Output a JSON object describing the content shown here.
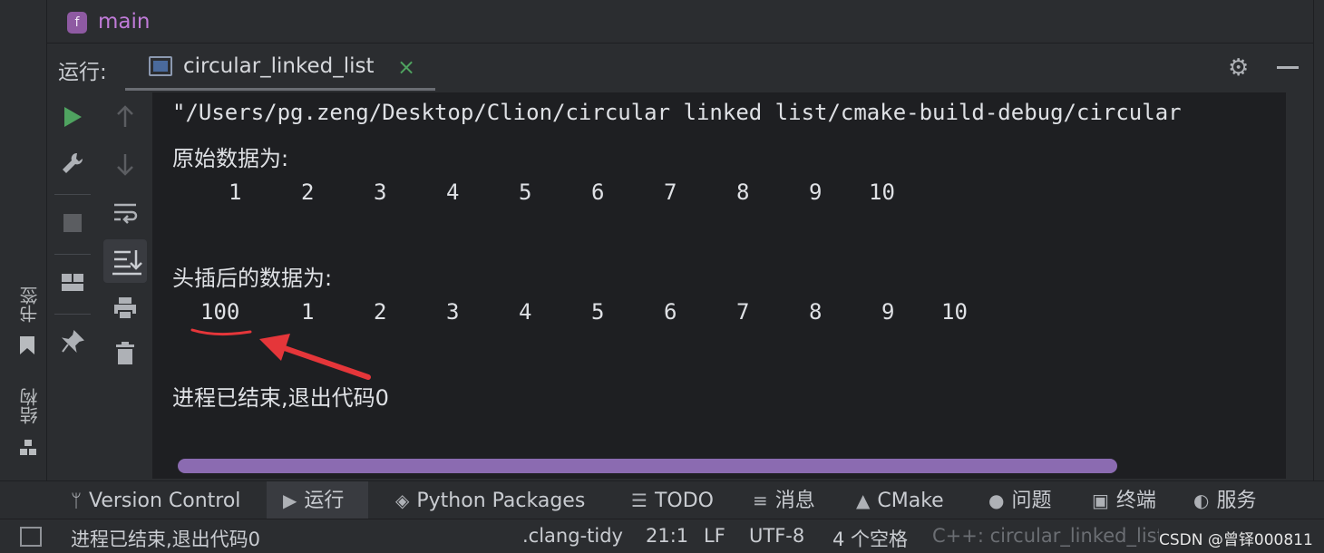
{
  "left_strip": {
    "bookmarks_label": "书签",
    "structure_label": "结构"
  },
  "file_bar": {
    "file_icon_letter": "f",
    "file_name": "main"
  },
  "run_panel": {
    "label": "运行:",
    "tab_name": "circular_linked_list",
    "close_glyph": "×"
  },
  "console": {
    "command": "\"/Users/pg.zeng/Desktop/Clion/circular linked list/cmake-build-debug/circular",
    "header_original": "原始数据为:",
    "original_values": [
      "1",
      "2",
      "3",
      "4",
      "5",
      "6",
      "7",
      "8",
      "9",
      "10"
    ],
    "header_inserted": "头插后的数据为:",
    "inserted_values": [
      "100",
      "1",
      "2",
      "3",
      "4",
      "5",
      "6",
      "7",
      "8",
      "9",
      "10"
    ],
    "exit_message": "进程已结束,退出代码0"
  },
  "tool_windows": [
    {
      "label": "Version Control",
      "icon": "branch-icon"
    },
    {
      "label": "运行",
      "icon": "play-icon"
    },
    {
      "label": "Python Packages",
      "icon": "layers-icon"
    },
    {
      "label": "TODO",
      "icon": "list-icon"
    },
    {
      "label": "消息",
      "icon": "message-icon"
    },
    {
      "label": "CMake",
      "icon": "triangle-icon"
    },
    {
      "label": "问题",
      "icon": "alert-icon"
    },
    {
      "label": "终端",
      "icon": "terminal-icon"
    },
    {
      "label": "服务",
      "icon": "services-icon"
    }
  ],
  "status_bar": {
    "message": "进程已结束,退出代码0",
    "linter": ".clang-tidy",
    "position": "21:1",
    "line_ending": "LF",
    "encoding": "UTF-8",
    "indent": "4 个空格",
    "context": "C++: circular_linked_list",
    "watermark": "CSDN @曾铎000811"
  },
  "colors": {
    "accent_run": "#4fa360",
    "annotation_red": "#e5363a",
    "scroll_thumb": "#8b6bb1",
    "file_name": "#c07bd8"
  }
}
